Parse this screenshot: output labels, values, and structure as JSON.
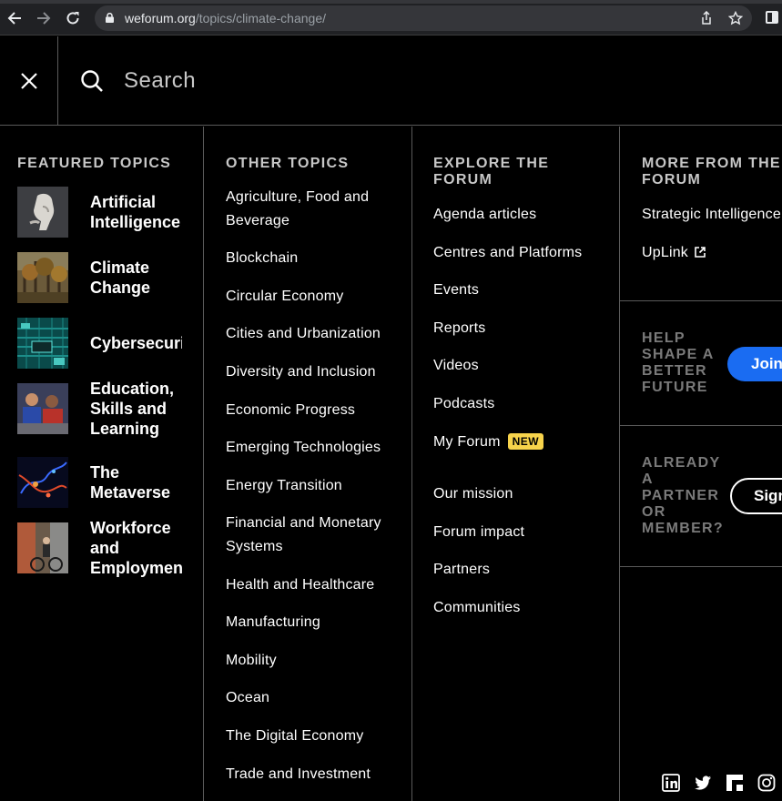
{
  "browser": {
    "url_domain": "weforum.org",
    "url_path": "/topics/climate-change/"
  },
  "search": {
    "placeholder": "Search"
  },
  "featured": {
    "heading": "Featured Topics",
    "items": [
      {
        "label": "Artificial\nIntelligence",
        "thumb": "robot-hand-image"
      },
      {
        "label": "Climate\nChange",
        "thumb": "forest-image"
      },
      {
        "label": "Cybersecurity",
        "thumb": "circuit-board-image"
      },
      {
        "label": "Education,\nSkills and\nLearning",
        "thumb": "students-image"
      },
      {
        "label": "The\nMetaverse",
        "thumb": "abstract-lights-image"
      },
      {
        "label": "Workforce\nand\nEmployment",
        "thumb": "cyclist-street-image"
      }
    ]
  },
  "other_topics": {
    "heading": "Other Topics",
    "items": [
      "Agriculture, Food and Beverage",
      "Blockchain",
      "Circular Economy",
      "Cities and Urbanization",
      "Diversity and Inclusion",
      "Economic Progress",
      "Emerging Technologies",
      "Energy Transition",
      "Financial and Monetary Systems",
      "Health and Healthcare",
      "Manufacturing",
      "Mobility",
      "Ocean",
      "The Digital Economy",
      "Trade and Investment"
    ]
  },
  "explore": {
    "heading": "Explore the Forum",
    "items": [
      "Agenda articles",
      "Centres and Platforms",
      "Events",
      "Reports",
      "Videos",
      "Podcasts",
      "My Forum",
      "Our mission",
      "Forum impact",
      "Partners",
      "Communities"
    ],
    "new_badge": "NEW"
  },
  "more": {
    "heading": "More from the Forum",
    "items": [
      "Strategic Intelligence",
      "UpLink"
    ],
    "help_heading": "Help shape a better future",
    "join_label": "Join us",
    "partner_heading": "Already a partner or member?",
    "sign_label": "Sign in"
  },
  "social": [
    "linkedin-icon",
    "twitter-icon",
    "flipboard-icon",
    "instagram-icon"
  ],
  "colors": {
    "background": "#000000",
    "accent_blue": "#1a6cf2",
    "badge_yellow": "#f7d34b",
    "divider": "#5a5a5a"
  }
}
